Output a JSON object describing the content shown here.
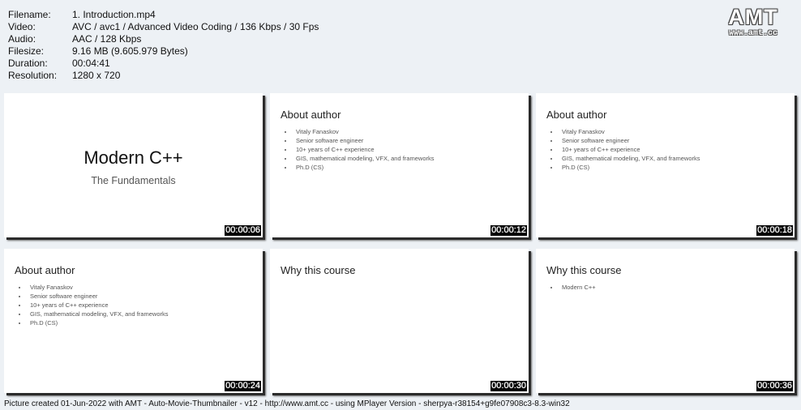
{
  "info": [
    {
      "key": "Filename:",
      "value": "1. Introduction.mp4"
    },
    {
      "key": "Video:",
      "value": "AVC / avc1 / Advanced Video Coding / 136 Kbps / 30 Fps"
    },
    {
      "key": "Audio:",
      "value": "AAC / 128 Kbps"
    },
    {
      "key": "Filesize:",
      "value": "9.16 MB (9.605.979 Bytes)"
    },
    {
      "key": "Duration:",
      "value": "00:04:41"
    },
    {
      "key": "Resolution:",
      "value": "1280 x 720"
    }
  ],
  "logo": {
    "text": "AMT",
    "url": "www.amt.cc"
  },
  "thumbnails": [
    {
      "type": "cover",
      "title": "Modern C++",
      "subtitle": "The Fundamentals",
      "timestamp": "00:00:06"
    },
    {
      "type": "slide",
      "title": "About author",
      "bullets": [
        "Vitaly Fanaskov",
        "Senior software engineer",
        "10+ years of C++ experience",
        "GIS, mathematical modeling, VFX, and frameworks",
        "Ph.D (CS)"
      ],
      "timestamp": "00:00:12"
    },
    {
      "type": "slide",
      "title": "About author",
      "bullets": [
        "Vitaly Fanaskov",
        "Senior software engineer",
        "10+ years of C++ experience",
        "GIS, mathematical modeling, VFX, and frameworks",
        "Ph.D (CS)"
      ],
      "timestamp": "00:00:18"
    },
    {
      "type": "slide",
      "title": "About author",
      "bullets": [
        "Vitaly Fanaskov",
        "Senior software engineer",
        "10+ years of C++ experience",
        "GIS, mathematical modeling, VFX, and frameworks",
        "Ph.D (CS)"
      ],
      "timestamp": "00:00:24"
    },
    {
      "type": "slide",
      "title": "Why this course",
      "bullets": [],
      "timestamp": "00:00:30"
    },
    {
      "type": "slide",
      "title": "Why this course",
      "bullets": [
        "Modern C++"
      ],
      "timestamp": "00:00:36"
    }
  ],
  "footer": "Picture created 01-Jun-2022 with AMT - Auto-Movie-Thumbnailer - v12 - http://www.amt.cc - using MPlayer Version - sherpya-r38154+g9fe07908c3-8.3-win32"
}
